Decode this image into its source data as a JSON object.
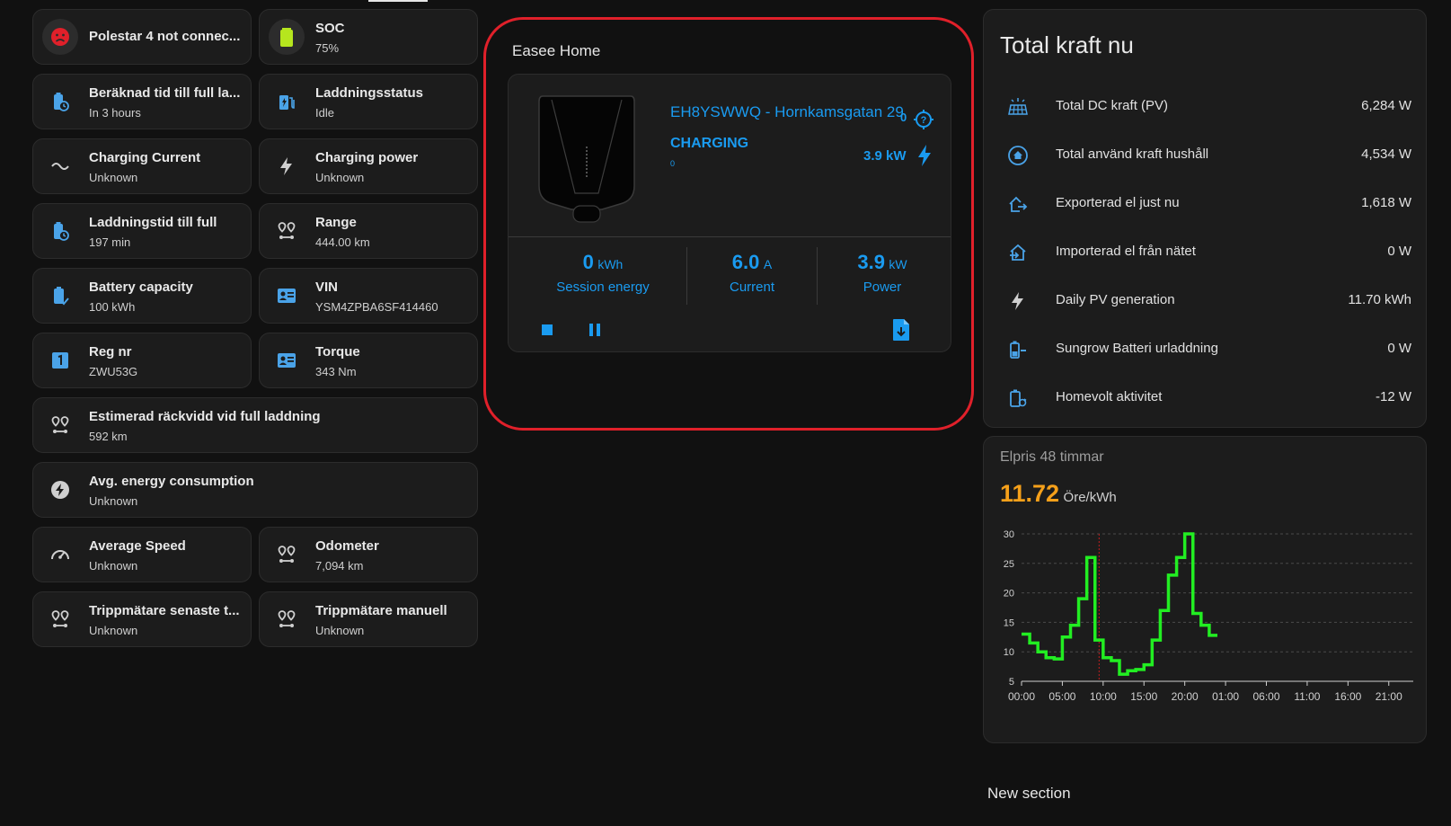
{
  "tiles": [
    {
      "name": "polestar-status",
      "title": "Polestar 4 not connec...",
      "sub": "",
      "icon": "sad-face-icon"
    },
    {
      "name": "soc",
      "title": "SOC",
      "sub": "75%",
      "icon": "battery-icon"
    },
    {
      "name": "calc-time-full",
      "title": "Beräknad tid till full la...",
      "sub": "In 3 hours",
      "icon": "battery-clock-icon"
    },
    {
      "name": "charging-status",
      "title": "Laddningsstatus",
      "sub": "Idle",
      "icon": "ev-station-icon"
    },
    {
      "name": "charging-current",
      "title": "Charging Current",
      "sub": "Unknown",
      "icon": "current-ac-icon"
    },
    {
      "name": "charging-power",
      "title": "Charging power",
      "sub": "Unknown",
      "icon": "flash-icon"
    },
    {
      "name": "charge-time-full",
      "title": "Laddningstid till full",
      "sub": "197 min",
      "icon": "battery-clock-icon"
    },
    {
      "name": "range",
      "title": "Range",
      "sub": "444.00 km",
      "icon": "map-marker-distance-icon"
    },
    {
      "name": "battery-capacity",
      "title": "Battery capacity",
      "sub": "100 kWh",
      "icon": "battery-check-icon"
    },
    {
      "name": "vin",
      "title": "VIN",
      "sub": "YSM4ZPBA6SF414460",
      "icon": "card-account-icon"
    },
    {
      "name": "reg-nr",
      "title": "Reg nr",
      "sub": "ZWU53G",
      "icon": "numeric-1-box-icon"
    },
    {
      "name": "torque",
      "title": "Torque",
      "sub": "343 Nm",
      "icon": "card-account-icon"
    },
    {
      "name": "estimated-range-full",
      "title": "Estimerad räckvidd vid full laddning",
      "sub": "592 km",
      "icon": "map-marker-distance-icon"
    },
    {
      "name": "avg-energy",
      "title": "Avg. energy consumption",
      "sub": "Unknown",
      "icon": "lightning-circle-icon"
    },
    {
      "name": "average-speed",
      "title": "Average Speed",
      "sub": "Unknown",
      "icon": "speedometer-icon"
    },
    {
      "name": "odometer",
      "title": "Odometer",
      "sub": "7,094 km",
      "icon": "map-marker-distance-icon"
    },
    {
      "name": "trip-latest",
      "title": "Trippmätare senaste t...",
      "sub": "Unknown",
      "icon": "map-marker-distance-icon"
    },
    {
      "name": "trip-manual",
      "title": "Trippmätare manuell",
      "sub": "Unknown",
      "icon": "map-marker-distance-icon"
    }
  ],
  "easee": {
    "section_title": "Easee Home",
    "charger_name": "EH8YSWWQ - Hornkamsgatan 29",
    "status": "CHARGING",
    "status_sub": "0",
    "top_right_value": "0",
    "power_label": "3.9 kW",
    "session_energy_value": "0",
    "session_energy_unit": "kWh",
    "session_energy_label": "Session energy",
    "current_value": "6.0",
    "current_unit": "A",
    "current_label": "Current",
    "power_value": "3.9",
    "power_unit": "kW",
    "power_stat_label": "Power"
  },
  "power": {
    "title": "Total kraft nu",
    "rows": [
      {
        "label": "Total DC kraft (PV)",
        "value": "6,284 W",
        "icon": "solar-panel-icon"
      },
      {
        "label": "Total använd kraft hushåll",
        "value": "4,534 W",
        "icon": "home-circle-icon"
      },
      {
        "label": "Exporterad el just nu",
        "value": "1,618 W",
        "icon": "home-export-icon"
      },
      {
        "label": "Importerad el från nätet",
        "value": "0 W",
        "icon": "home-import-icon"
      },
      {
        "label": "Daily PV generation",
        "value": "11.70 kWh",
        "icon": "flash-icon"
      },
      {
        "label": "Sungrow Batteri urladdning",
        "value": "0 W",
        "icon": "battery-minus-icon"
      },
      {
        "label": "Homevolt aktivitet",
        "value": "-12 W",
        "icon": "battery-sync-icon"
      }
    ]
  },
  "price": {
    "title": "Elpris 48 timmar",
    "value": "11.72",
    "unit": "Öre/kWh",
    "value_color": "#f5a01a"
  },
  "chart_data": {
    "type": "line",
    "x_ticks": [
      "00:00",
      "05:00",
      "10:00",
      "15:00",
      "20:00",
      "01:00",
      "06:00",
      "11:00",
      "16:00",
      "21:00"
    ],
    "y_ticks": [
      5,
      10,
      15,
      20,
      25,
      30
    ],
    "ylim": [
      5,
      30
    ],
    "xlim": [
      0,
      48
    ],
    "now_marker_hour": 9.5,
    "series": [
      {
        "color": "#22ee22",
        "step": true,
        "values": [
          13,
          11.5,
          10,
          9,
          8.8,
          12.5,
          14.5,
          19,
          26,
          12,
          9,
          8.5,
          6.2,
          6.8,
          7,
          7.8,
          12,
          17,
          23,
          26,
          30,
          16.5,
          14.5,
          12.8
        ]
      }
    ]
  },
  "footer": {
    "new_section": "New section"
  },
  "colors": {
    "accent": "#1a9bf0",
    "ring": "#e0202a",
    "line": "#22ee22"
  }
}
